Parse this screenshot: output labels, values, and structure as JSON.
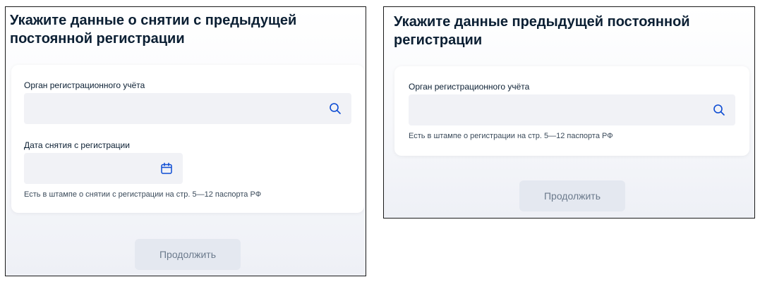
{
  "colors": {
    "accent": "#0d4cd3",
    "field_bg": "#f1f2f6",
    "button_bg": "#e4e8f0"
  },
  "left_form": {
    "title": "Укажите данные о снятии с предыдущей постоянной регистрации",
    "org_label": "Орган регистрационного учёта",
    "org_value": "",
    "org_icon": "search-icon",
    "date_label": "Дата снятия с регистрации",
    "date_value": "",
    "date_icon": "calendar-icon",
    "hint": "Есть в штампе о снятии с регистрации на стр. 5—12 паспорта РФ",
    "continue_label": "Продолжить"
  },
  "right_form": {
    "title": "Укажите данные предыдущей постоянной регистрации",
    "org_label": "Орган регистрационного учёта",
    "org_value": "",
    "org_icon": "search-icon",
    "hint": "Есть в штампе о регистрации на стр. 5—12 паспорта РФ",
    "continue_label": "Продолжить"
  }
}
